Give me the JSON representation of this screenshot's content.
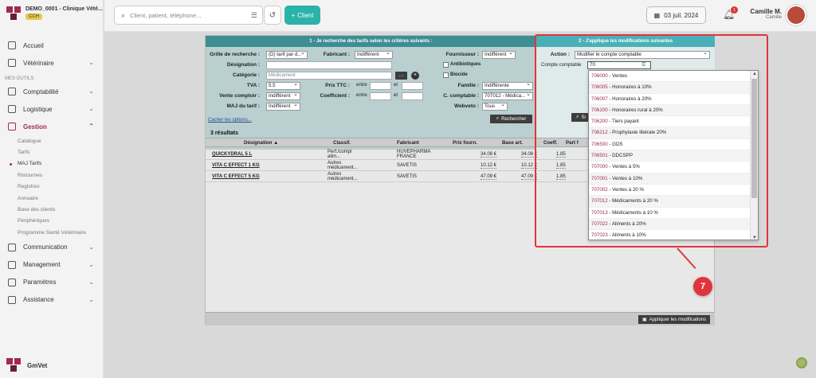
{
  "brand": {
    "clinic": "DEMO_0001 - Clinique Vété...",
    "badge": "CCH",
    "app_name": "GmVet"
  },
  "nav": {
    "accueil": "Accueil",
    "veterinaire": "Vétérinaire",
    "section": "MES OUTILS",
    "comptabilite": "Comptabilité",
    "logistique": "Logistique",
    "gestion": "Gestion",
    "gestion_sub": [
      "Catalogue",
      "Tarifs",
      "MAJ Tarifs",
      "Ristournes",
      "Registres",
      "Annuaire",
      "Base des clients",
      "Périphériques",
      "Programme Santé Vétérinaire"
    ],
    "communication": "Communication",
    "management": "Management",
    "parametres": "Paramètres",
    "assistance": "Assistance"
  },
  "topbar": {
    "search_placeholder": "Client, patient, téléphone...",
    "client_button": "Client",
    "date": "03 juil. 2024",
    "notifications": "1",
    "user_name": "Camille M.",
    "user_role": "Camille"
  },
  "criteria": {
    "header": "1 - Je recherche des tarifs selon les critères suivants :",
    "grille_label": "Grille de recherche :",
    "grille_value": "(D) tarif par d...",
    "fabricant_label": "Fabricant :",
    "fabricant_value": "Indifférent",
    "fournisseur_label": "Fournisseur :",
    "fournisseur_value": "Indifférent",
    "designation_label": "Désignation :",
    "antibiotiques_label": "Antibiotiques",
    "categorie_label": "Catégorie :",
    "categorie_value": "Médicament",
    "biocide_label": "Biocide",
    "tva_label": "TVA :",
    "tva_value": "5.5",
    "prix_ttc_label": "Prix TTC :",
    "entre_label": "entre",
    "et_label": "et",
    "famille_label": "Famille :",
    "famille_value": "Indifférente",
    "vente_label": "Vente comptoir :",
    "vente_value": "Indifférent",
    "coef_label": "Coefficient :",
    "compta_label": "C. comptable :",
    "compta_value": "707012 - Médica...",
    "maj_label": "MAJ du tarif :",
    "maj_value": "Indifférent",
    "webveto_label": "Webveto :",
    "webveto_value": "Tous",
    "cacher_link": "Cacher les options...",
    "rechercher_button": "Rechercher"
  },
  "modifications": {
    "header": "2 - J'applique les modifications suivantes",
    "action_label": "Action :",
    "action_value": "Modifier le compte comptable",
    "compte_label": "Compte comptable",
    "compte_value": "70",
    "simuler_button": "Si"
  },
  "results": {
    "count": "3 résultats",
    "columns": [
      "Désignation ▲",
      "Classif.",
      "Fabricant",
      "Prix fourn.",
      "Base art.",
      "Coeff.",
      "Part f"
    ],
    "rows": [
      {
        "designation": "QUICKYDRAL 5 L",
        "classif": "Perf./compl alim...",
        "fabricant": "HUVEPHARMA FRANCE",
        "prix_fourn": "34.08 €",
        "base_art": "34.08 €",
        "coeff": "1.85"
      },
      {
        "designation": "VITA C EFFECT 1 KG",
        "classif": "Autres médicament...",
        "fabricant": "SAVETIS",
        "prix_fourn": "10.12 €",
        "base_art": "10.12 €",
        "coeff": "1.85"
      },
      {
        "designation": "VITA C EFFECT 5 KG",
        "classif": "Autres médicament...",
        "fabricant": "SAVETIS",
        "prix_fourn": "47.09 €",
        "base_art": "47.09 €",
        "coeff": "1.85"
      }
    ],
    "apply_button": "Appliquer les modifications"
  },
  "dropdown_options": [
    {
      "code": "706000",
      "label": " - Ventes"
    },
    {
      "code": "706005",
      "label": " - Honoraires à 10%"
    },
    {
      "code": "706007",
      "label": " - Honoraires à 20%"
    },
    {
      "code": "706100",
      "label": " - Honoraires rural à 20%"
    },
    {
      "code": "706200",
      "label": " - Tiers payant"
    },
    {
      "code": "706212",
      "label": " - Prophylaxie libérale 20%"
    },
    {
      "code": "706500",
      "label": " - GDS"
    },
    {
      "code": "706501",
      "label": " - DDCSPP"
    },
    {
      "code": "707000",
      "label": " - Ventes à 5%"
    },
    {
      "code": "707001",
      "label": " - Ventes à 10%"
    },
    {
      "code": "707002",
      "label": " - Ventes à 20 %"
    },
    {
      "code": "707012",
      "label": " - Médicaments à 20 %"
    },
    {
      "code": "707013",
      "label": " - Médicaments à 10 %"
    },
    {
      "code": "707022",
      "label": " - Aliments à 20%"
    },
    {
      "code": "707023",
      "label": " - Aliments à 10%"
    }
  ],
  "callout_number": "7",
  "colors": {
    "brand": "#a12a4c",
    "accent": "#2ab3a8",
    "highlight": "#e0353c",
    "header_left": "#3c8e94",
    "header_right": "#4ab0b8"
  }
}
